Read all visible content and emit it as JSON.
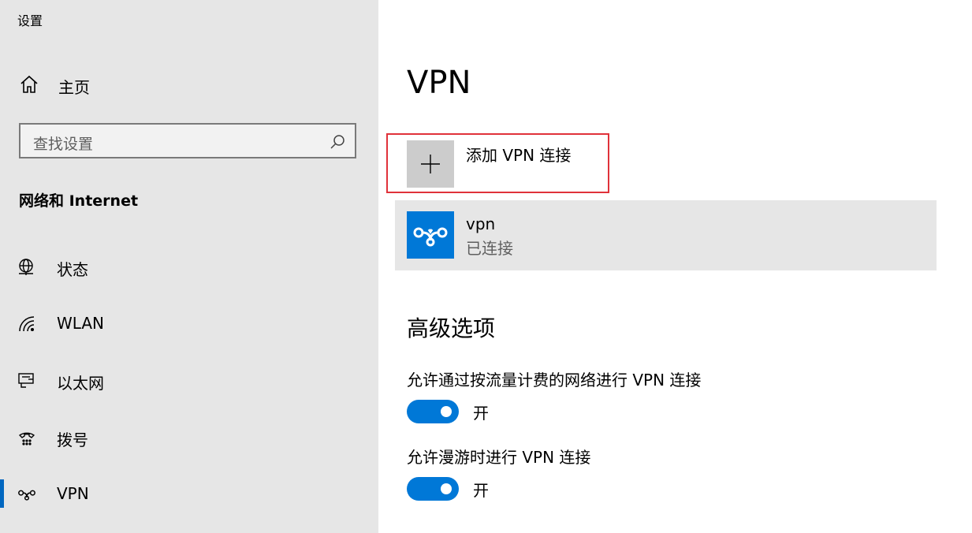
{
  "app": {
    "title": "设置"
  },
  "sidebar": {
    "home_label": "主页",
    "search": {
      "placeholder": "查找设置"
    },
    "section_title": "网络和 Internet",
    "items": [
      {
        "label": "状态",
        "icon": "globe-status-icon",
        "active": false
      },
      {
        "label": "WLAN",
        "icon": "wifi-icon",
        "active": false
      },
      {
        "label": "以太网",
        "icon": "ethernet-icon",
        "active": false
      },
      {
        "label": "拨号",
        "icon": "dialup-icon",
        "active": false
      },
      {
        "label": "VPN",
        "icon": "vpn-icon",
        "active": true
      }
    ]
  },
  "main": {
    "title": "VPN",
    "add_vpn_label": "添加 VPN 连接",
    "connection": {
      "name": "vpn",
      "status": "已连接"
    },
    "advanced_title": "高级选项",
    "options": [
      {
        "label": "允许通过按流量计费的网络进行 VPN 连接",
        "state": "开",
        "on": true
      },
      {
        "label": "允许漫游时进行 VPN 连接",
        "state": "开",
        "on": true
      }
    ]
  },
  "colors": {
    "accent": "#0078d7",
    "highlight_border": "#e0323a",
    "sidebar_bg": "#e6e6e6"
  }
}
